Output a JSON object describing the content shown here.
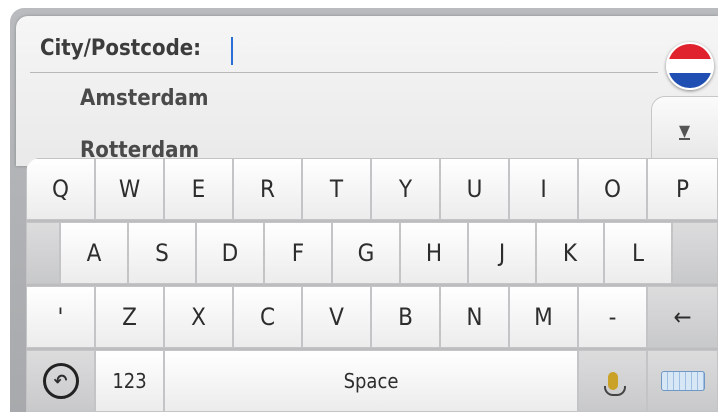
{
  "search": {
    "label": "City/Postcode:"
  },
  "results": [
    "Amsterdam",
    "Rotterdam"
  ],
  "scroll": {
    "icon": "▼"
  },
  "keyboard": {
    "row1": [
      "Q",
      "W",
      "E",
      "R",
      "T",
      "Y",
      "U",
      "I",
      "O",
      "P"
    ],
    "row2": [
      "A",
      "S",
      "D",
      "F",
      "G",
      "H",
      "J",
      "K",
      "L"
    ],
    "row3": [
      "'",
      "Z",
      "X",
      "C",
      "V",
      "B",
      "N",
      "M",
      "-"
    ],
    "backspace": "←",
    "numbers": "123",
    "space": "Space"
  },
  "colors": {
    "caret": "#2a6fd8",
    "flag_red": "#e0222e",
    "flag_blue": "#1f4fb3"
  }
}
